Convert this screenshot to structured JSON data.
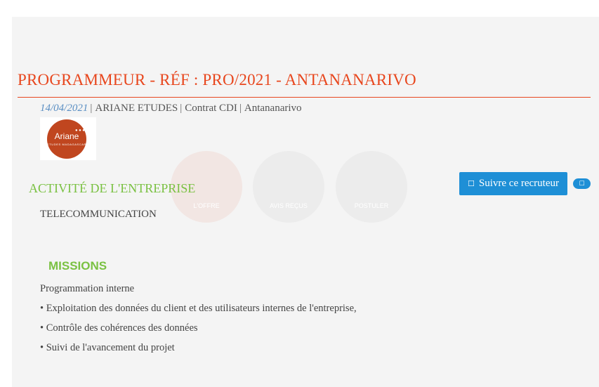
{
  "job": {
    "title": "PROGRAMMEUR - RÉF : PRO/2021 - ANTANANARIVO",
    "date": "14/04/2021",
    "company": "ARIANE ETUDES",
    "contract": "Contrat CDI",
    "location": "Antananarivo",
    "separator": "|"
  },
  "logo": {
    "word": "Ariane",
    "dots": "● ● ●",
    "subtitle": "ETUDES MADAGASCAR",
    "color": "#c0461f"
  },
  "ghost_buttons": [
    "L'OFFRE",
    "AVIS REÇUS",
    "POSTULER"
  ],
  "follow": {
    "icon": "follow-icon",
    "glyph": "☐",
    "label": "Suivre ce recruteur",
    "badge_icon": "counter-icon",
    "badge_glyph": "☐",
    "color": "#1e8fd6"
  },
  "activite": {
    "heading": "ACTIVITÉ DE L'ENTREPRISE",
    "value": "TELECOMMUNICATION"
  },
  "missions": {
    "heading": "MISSIONS",
    "items": [
      "Programmation interne",
      "• Exploitation des données du client et des utilisateurs internes de l'entreprise,",
      "• Contrôle des cohérences des données",
      "• Suivi de l'avancement du projet"
    ]
  },
  "colors": {
    "title": "#e8471e",
    "section": "#7ac142",
    "date": "#5b8fc3"
  }
}
